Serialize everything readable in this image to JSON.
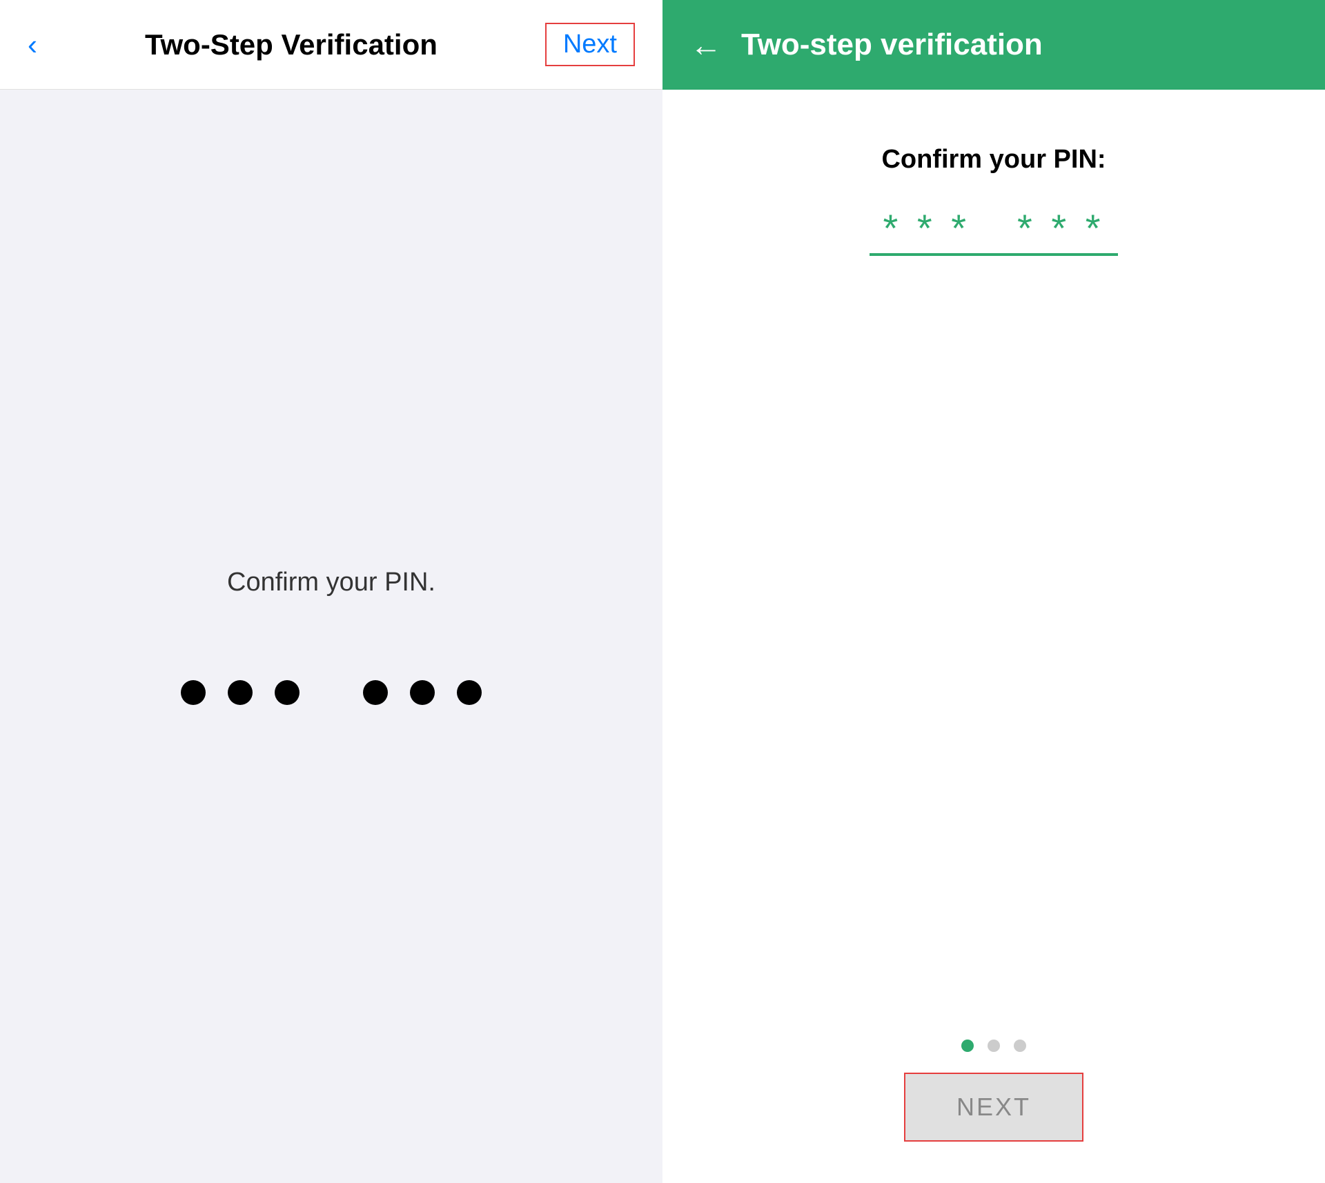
{
  "left": {
    "back_icon": "‹",
    "title": "Two-Step Verification",
    "next_label": "Next",
    "prompt": "Confirm your PIN.",
    "pin_count": 6
  },
  "right": {
    "back_icon": "←",
    "title": "Two-step verification",
    "prompt": "Confirm your PIN:",
    "asterisks_group1": "* * *",
    "asterisks_group2": "* * *",
    "pagination": {
      "dots": [
        {
          "active": true
        },
        {
          "active": false
        },
        {
          "active": false
        }
      ]
    },
    "next_button_label": "NEXT"
  }
}
